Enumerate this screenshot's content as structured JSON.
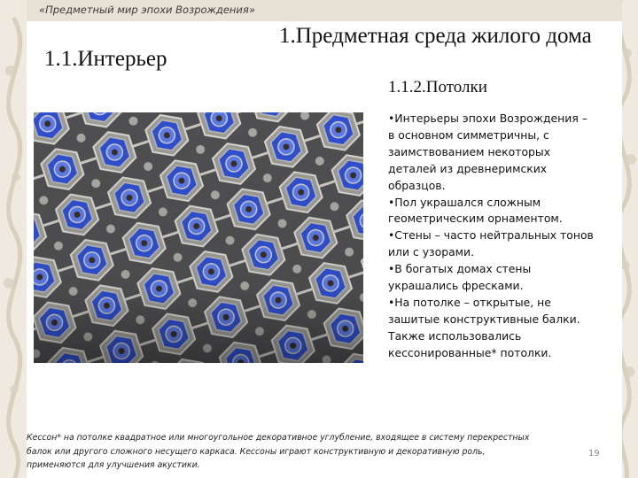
{
  "header": {
    "text": "«Предметный мир эпохи Возрождения»"
  },
  "section_title": "1.1.Интерьер",
  "main_title": "1.Предметная среда жилого дома",
  "subtitle": "1.1.2.Потолки",
  "bullet_lines": [
    "•Интерьеры эпохи Возрождения –",
    "в основном симметричны, с",
    "заимствованием некоторых",
    "деталей из древнеримских",
    "образцов.",
    "•Пол украшался сложным",
    "геометрическим орнаментом.",
    "•Стены – часто нейтральных тонов",
    "или с узорами.",
    "•В богатых домах стены",
    "украшались фресками.",
    "•На потолке – открытые, не",
    "зашитые конструктивные балки.",
    "Также использовались",
    "кессонированные* потолки."
  ],
  "footnote_lines": [
    "Кессон* на потолке квадратное или многоугольное декоративное углубление, входящее в систему перекрестных",
    "балок или другого сложного несущего каркаса. Кессоны играют конструктивную и декоративную роль,",
    "применяются для улучшения акустики."
  ],
  "page_number": "19",
  "colors": {
    "ornament": "#ddd4c6",
    "header_band": "#e8e1d6",
    "ceiling_frame": "#b7b5b0",
    "ceiling_blue": "#2f4fcf"
  }
}
